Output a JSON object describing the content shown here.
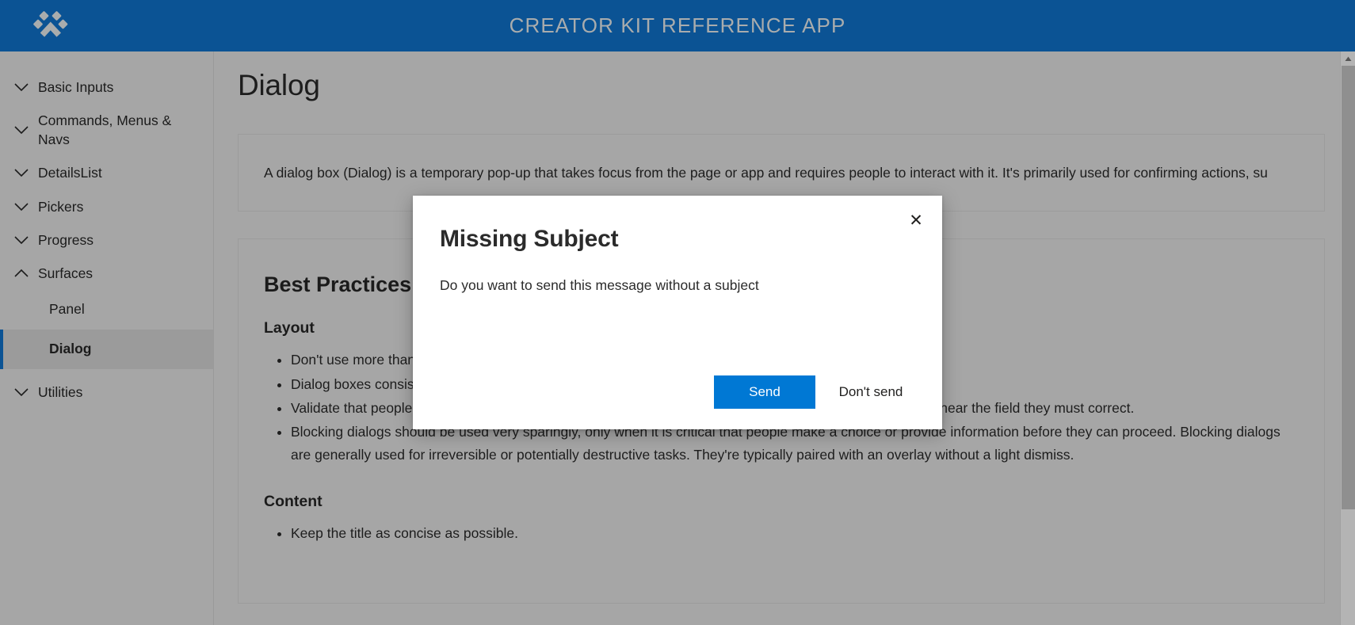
{
  "header": {
    "title": "CREATOR KIT REFERENCE APP",
    "logo_icon": "paw-diamonds-logo",
    "background_color": "#0b5394",
    "title_color": "#a9acad"
  },
  "sidebar": {
    "groups": [
      {
        "label": "Basic Inputs",
        "icon": "chevron-down-icon",
        "expanded": false
      },
      {
        "label": "Commands, Menus & Navs",
        "icon": "chevron-down-icon",
        "expanded": false
      },
      {
        "label": "DetailsList",
        "icon": "chevron-down-icon",
        "expanded": false
      },
      {
        "label": "Pickers",
        "icon": "chevron-down-icon",
        "expanded": false
      },
      {
        "label": "Progress",
        "icon": "chevron-down-icon",
        "expanded": false
      },
      {
        "label": "Surfaces",
        "icon": "chevron-up-icon",
        "expanded": true
      },
      {
        "label": "Utilities",
        "icon": "chevron-down-icon",
        "expanded": false
      }
    ],
    "surfaces_children": [
      {
        "label": "Panel",
        "selected": false
      },
      {
        "label": "Dialog",
        "selected": true
      }
    ],
    "selection_accent_color": "#0b5394"
  },
  "content": {
    "page_title": "Dialog",
    "intro": "A dialog box (Dialog) is a temporary pop-up that takes focus from the page or app and requires people to interact with it. It's primarily used for confirming actions, su",
    "best_practices_heading": "Best Practices",
    "layout_heading": "Layout",
    "layout_bullets": [
      "Don't use more than three buttons.",
      "Dialog boxes consist of a header, body, and footer.",
      "Validate that people's entries are acceptable before closing the dialog box. Show an inline validation error near the field they must correct.",
      "Blocking dialogs should be used very sparingly, only when it is critical that people make a choice or provide information before they can proceed. Blocking dialogs are generally used for irreversible or potentially destructive tasks. They're typically paired with an overlay without a light dismiss."
    ],
    "content_heading": "Content",
    "content_bullets": [
      "Keep the title as concise as possible."
    ]
  },
  "dialog": {
    "title": "Missing Subject",
    "message": "Do you want to send this message without a subject",
    "close_icon": "close-icon",
    "close_glyph": "✕",
    "primary_button": "Send",
    "secondary_button": "Don't send",
    "primary_color": "#0078d4"
  },
  "scrollbar": {
    "up_arrow_icon": "scroll-up-arrow-icon"
  }
}
